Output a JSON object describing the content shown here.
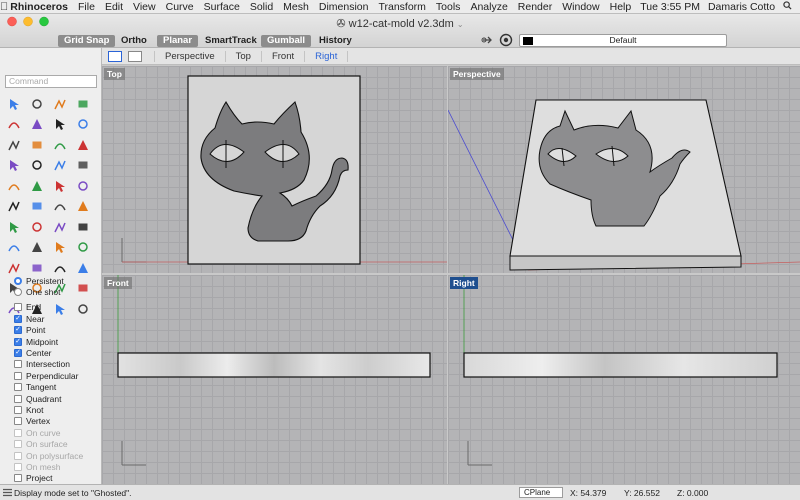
{
  "menubar": {
    "app_name": "Rhinoceros",
    "items": [
      "File",
      "Edit",
      "View",
      "Curve",
      "Surface",
      "Solid",
      "Mesh",
      "Dimension",
      "Transform",
      "Tools",
      "Analyze",
      "Render",
      "Window",
      "Help"
    ],
    "clock": "Tue 3:55 PM",
    "user": "Damaris Cotto"
  },
  "window": {
    "title": "w12-cat-mold v2.3dm"
  },
  "toolbar": {
    "grid_snap": "Grid Snap",
    "ortho": "Ortho",
    "planar": "Planar",
    "smarttrack": "SmartTrack",
    "gumball": "Gumball",
    "history": "History",
    "display_mode": "Default"
  },
  "viewport_tabs": [
    "Perspective",
    "Top",
    "Front",
    "Right"
  ],
  "command": {
    "placeholder": "Command"
  },
  "tools": [
    "select-arrow-icon",
    "point-icon",
    "polyline-icon",
    "curve-icon",
    "select-point-icon",
    "circle-icon",
    "arc-icon",
    "rectangle-icon",
    "ellipse-icon",
    "polygon-icon",
    "offset-icon",
    "fillet-icon",
    "surface-icon",
    "extrude-icon",
    "loft-icon",
    "sweep-icon",
    "box-icon",
    "sphere-icon",
    "cylinder-icon",
    "cone-icon",
    "torus-icon",
    "boolean-icon",
    "mesh-icon",
    "text-icon",
    "dimension-icon",
    "move-icon",
    "copy-icon",
    "rotate-icon",
    "scale-icon",
    "mirror-icon",
    "array-icon",
    "trim-icon",
    "split-icon",
    "join-icon",
    "explode-icon",
    "group-icon",
    "layer-icon",
    "properties-icon",
    "render-icon",
    "light-icon",
    "camera-icon",
    "car-icon",
    "color-wheel-icon",
    "grid-icon"
  ],
  "osnap": {
    "modes": [
      {
        "label": "Persistent",
        "on": true
      },
      {
        "label": "One shot",
        "on": false
      }
    ],
    "items": [
      {
        "label": "End",
        "on": false,
        "enabled": true
      },
      {
        "label": "Near",
        "on": true,
        "enabled": true
      },
      {
        "label": "Point",
        "on": true,
        "enabled": true
      },
      {
        "label": "Midpoint",
        "on": true,
        "enabled": true
      },
      {
        "label": "Center",
        "on": true,
        "enabled": true
      },
      {
        "label": "Intersection",
        "on": false,
        "enabled": true
      },
      {
        "label": "Perpendicular",
        "on": false,
        "enabled": true
      },
      {
        "label": "Tangent",
        "on": false,
        "enabled": true
      },
      {
        "label": "Quadrant",
        "on": false,
        "enabled": true
      },
      {
        "label": "Knot",
        "on": false,
        "enabled": true
      },
      {
        "label": "Vertex",
        "on": false,
        "enabled": true
      },
      {
        "label": "On curve",
        "on": false,
        "enabled": false
      },
      {
        "label": "On surface",
        "on": false,
        "enabled": false
      },
      {
        "label": "On polysurface",
        "on": false,
        "enabled": false
      },
      {
        "label": "On mesh",
        "on": false,
        "enabled": false
      },
      {
        "label": "Project",
        "on": false,
        "enabled": true
      }
    ]
  },
  "viewports": {
    "top": "Top",
    "perspective": "Perspective",
    "front": "Front",
    "right": "Right"
  },
  "statusbar": {
    "message": "Display mode set to \"Ghosted\".",
    "cplane": "CPlane",
    "x": "X: 54.379",
    "y": "Y: 26.552",
    "z": "Z: 0.000"
  },
  "colors": {
    "accent": "#3b7ee8",
    "active_viewport_label": "#1f4f8f",
    "viewport_bg": "#b4b4b6",
    "model_face": "#d4d4d4"
  }
}
